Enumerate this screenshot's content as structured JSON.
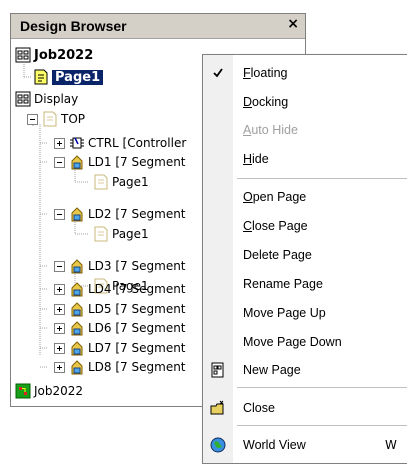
{
  "panel": {
    "title": "Design Browser",
    "close_glyph": "×"
  },
  "tree": [
    {
      "label": "Job2022",
      "style": "bold",
      "icon": "job-icon"
    },
    {
      "label": "Page1",
      "style": "selected",
      "icon": "page-yellow-icon"
    },
    {
      "label": "Display",
      "style": "normal",
      "icon": "job-icon"
    },
    {
      "label": "TOP",
      "style": "normal",
      "icon": "page-open-icon"
    },
    {
      "label": "CTRL [Controller",
      "style": "normal",
      "icon": "chip-icon"
    },
    {
      "label": "LD1 [7 Segment",
      "style": "normal",
      "icon": "component-icon"
    },
    {
      "label": "Page1",
      "style": "normal",
      "icon": "page-open-icon"
    },
    {
      "label": "LD2 [7 Segment",
      "style": "normal",
      "icon": "component-icon"
    },
    {
      "label": "Page1",
      "style": "normal",
      "icon": "page-open-icon"
    },
    {
      "label": "LD3 [7 Segment",
      "style": "normal",
      "icon": "component-icon"
    },
    {
      "label": "Page1",
      "style": "normal",
      "icon": "page-open-icon"
    },
    {
      "label": "LD4 [7 Segment",
      "style": "normal",
      "icon": "component-icon"
    },
    {
      "label": "LD5 [7 Segment",
      "style": "normal",
      "icon": "component-icon"
    },
    {
      "label": "LD6 [7 Segment",
      "style": "normal",
      "icon": "component-icon"
    },
    {
      "label": "LD7 [7 Segment",
      "style": "normal",
      "icon": "component-icon"
    },
    {
      "label": "LD8 [7 Segment",
      "style": "normal",
      "icon": "component-icon"
    },
    {
      "label": "Job2022",
      "style": "normal",
      "icon": "pcb-icon"
    }
  ],
  "menu": {
    "items": [
      {
        "key": "F",
        "rest": "loating",
        "checked": true,
        "enabled": true
      },
      {
        "key": "D",
        "rest": "ocking",
        "enabled": true
      },
      {
        "key": "A",
        "rest": "uto Hide",
        "enabled": false
      },
      {
        "key": "H",
        "rest": "ide",
        "enabled": true
      },
      {
        "key": "O",
        "rest": "pen Page",
        "enabled": true
      },
      {
        "key": "C",
        "rest": "lose Page",
        "enabled": true
      },
      {
        "label": "Delete Page",
        "enabled": true
      },
      {
        "label": "Rename Page",
        "enabled": true
      },
      {
        "label": "Move Page Up",
        "enabled": true
      },
      {
        "label": "Move Page Down",
        "enabled": true
      },
      {
        "label": "New Page",
        "enabled": true,
        "icon": "new-page-icon"
      },
      {
        "label": "Close",
        "enabled": true,
        "icon": "close-folder-icon"
      },
      {
        "label": "World View",
        "enabled": true,
        "icon": "globe-icon",
        "shortcut": "W"
      }
    ]
  },
  "colors": {
    "selection": "#0a246a",
    "titlebar": "#d4d0c8",
    "disabled_text": "#a0a0a0"
  }
}
